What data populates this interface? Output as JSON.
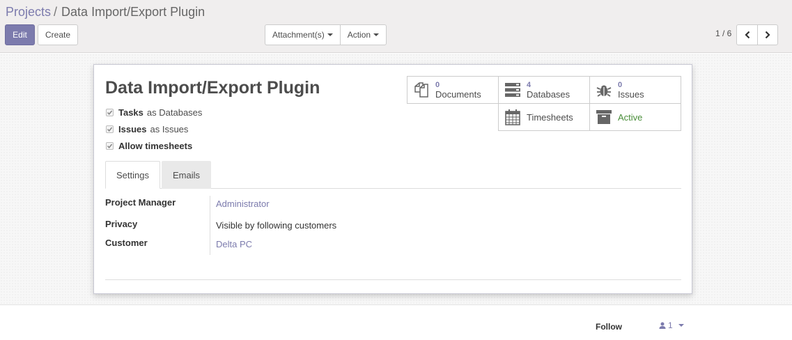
{
  "breadcrumb": {
    "parent": "Projects",
    "separator": "/",
    "current": "Data Import/Export Plugin"
  },
  "toolbar": {
    "edit_label": "Edit",
    "create_label": "Create",
    "attachments_label": "Attachment(s)",
    "action_label": "Action"
  },
  "pager": {
    "value": "1 / 6"
  },
  "record": {
    "title": "Data Import/Export Plugin",
    "checkboxes": [
      {
        "label": "Tasks",
        "suffix": "as Databases",
        "checked": true
      },
      {
        "label": "Issues",
        "suffix": "as Issues",
        "checked": true
      },
      {
        "label": "Allow timesheets",
        "suffix": "",
        "checked": true
      }
    ]
  },
  "smart_buttons": {
    "documents": {
      "count": "0",
      "label": "Documents",
      "icon": "documents-icon"
    },
    "databases": {
      "count": "4",
      "label": "Databases",
      "icon": "databases-icon"
    },
    "issues": {
      "count": "0",
      "label": "Issues",
      "icon": "bug-icon"
    },
    "timesheets": {
      "label": "Timesheets",
      "icon": "calendar-icon"
    },
    "active": {
      "label": "Active",
      "icon": "archive-icon"
    }
  },
  "tabs": [
    {
      "label": "Settings",
      "active": true
    },
    {
      "label": "Emails",
      "active": false
    }
  ],
  "fields": {
    "manager": {
      "label": "Project Manager",
      "value": "Administrator"
    },
    "privacy": {
      "label": "Privacy",
      "value": "Visible by following customers"
    },
    "customer": {
      "label": "Customer",
      "value": "Delta PC"
    }
  },
  "chatter": {
    "follow_label": "Follow",
    "followers_count": "1"
  },
  "colors": {
    "accent": "#7c7bad",
    "active_green": "#4a8e3a"
  }
}
